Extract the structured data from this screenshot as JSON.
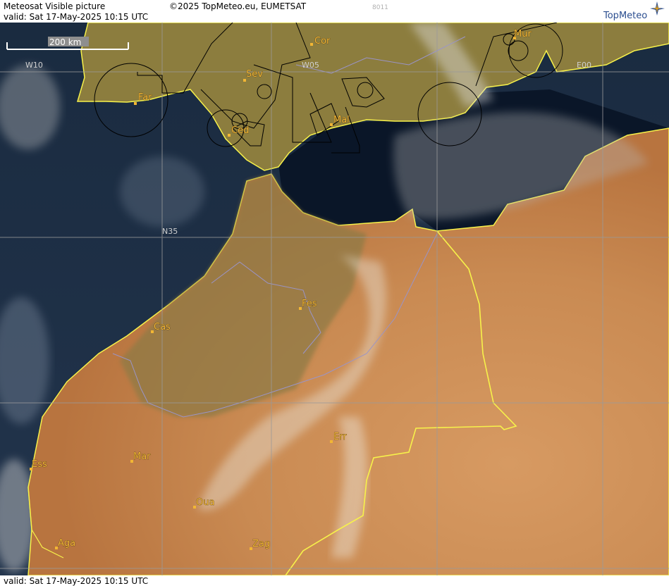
{
  "header": {
    "title": "Meteosat Visible picture",
    "valid": "valid:  Sat  17-May-2025  10:15 UTC",
    "copyright": "©2025 TopMeteo.eu, EUMETSAT",
    "code": "8011",
    "logo": "TopMeteo"
  },
  "footer": {
    "valid": "valid:  Sat  17-May-2025  10:15 UTC"
  },
  "scale": {
    "label": "200 km"
  },
  "grid_labels": {
    "w10": "W10",
    "w05": "W05",
    "e00": "E00",
    "n35": "N35"
  },
  "cities": {
    "cor": "Cor",
    "mur": "Mur",
    "sev": "Sev",
    "far": "Far",
    "ced": "Ced",
    "mal": "Mal",
    "fes": "Fes",
    "cas": "Cas",
    "err": "Err",
    "ess": "Ess",
    "mar": "Mar",
    "oua": "Oua",
    "aga": "Aga",
    "zag": "Zag"
  },
  "colors": {
    "sea": "#0f1f33",
    "land_north": "#8a7a3a",
    "land_desert": "#c98a52",
    "coast": "#f7f24a",
    "border": "#f7f24a",
    "grid": "#9a9a9a",
    "city_label": "#f2b634",
    "river": "#9a94c8"
  }
}
